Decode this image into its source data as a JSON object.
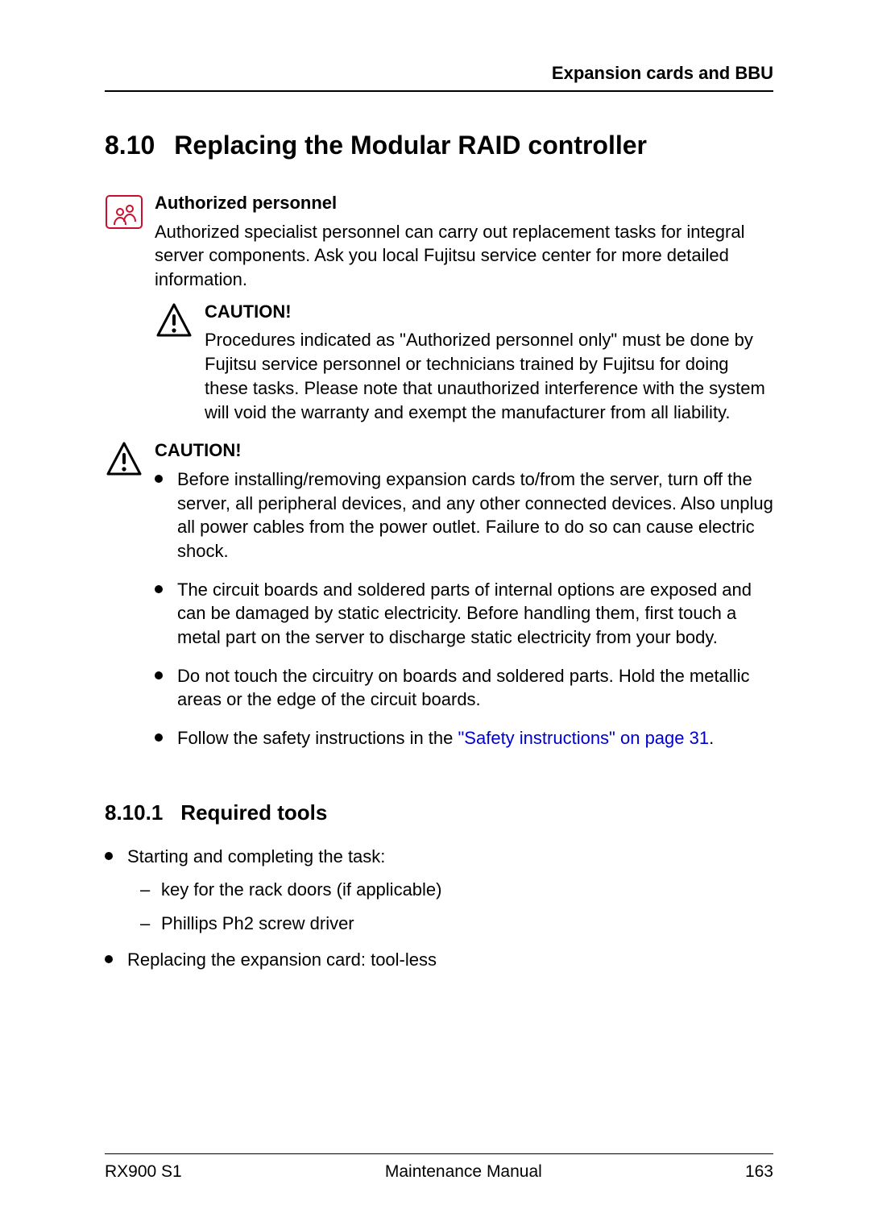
{
  "header": {
    "running": "Expansion cards and BBU"
  },
  "section": {
    "number": "8.10",
    "title": "Replacing the Modular RAID controller"
  },
  "authorized": {
    "heading": "Authorized personnel",
    "body": "Authorized specialist personnel can carry out replacement tasks for integral server components. Ask you local Fujitsu service center for more detailed information."
  },
  "caution_inner": {
    "heading": "CAUTION!",
    "body": "Procedures indicated as \"Authorized personnel only\" must be done by Fujitsu service personnel or technicians trained by Fujitsu for doing these tasks. Please note that unauthorized interference with the system will void the warranty and exempt the manufacturer from all liability."
  },
  "caution_outer": {
    "heading": "CAUTION!",
    "bullets": [
      "Before installing/removing expansion cards to/from the server, turn off the server, all peripheral devices, and any other connected devices. Also unplug all power cables from the power outlet. Failure to do so can cause electric shock.",
      "The circuit boards and soldered parts of internal options are exposed and can be damaged by static electricity. Before handling them, first touch a metal part on the server to discharge static electricity from your body.",
      "Do not touch the circuitry on boards and soldered parts. Hold the metallic areas or the edge of the circuit boards."
    ],
    "last_bullet_prefix": "Follow the safety instructions in the ",
    "last_bullet_link": "\"Safety instructions\" on page 31",
    "last_bullet_suffix": "."
  },
  "subsection": {
    "number": "8.10.1",
    "title": "Required tools"
  },
  "tools": {
    "items": [
      {
        "text": "Starting and completing the task:",
        "sub": [
          "key for the rack doors (if applicable)",
          "Phillips Ph2 screw driver"
        ]
      },
      {
        "text": "Replacing the expansion card: tool-less",
        "sub": []
      }
    ]
  },
  "footer": {
    "left": "RX900 S1",
    "center": "Maintenance Manual",
    "right": "163"
  }
}
